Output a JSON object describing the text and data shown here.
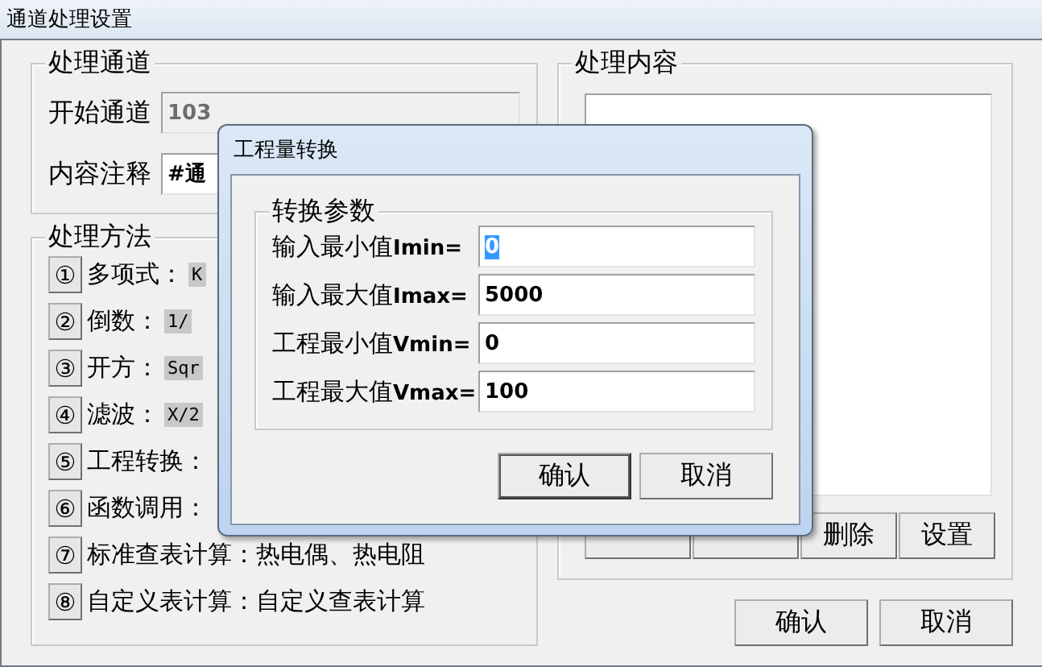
{
  "window": {
    "title": "通道处理设置"
  },
  "channel_group": {
    "title": "处理通道",
    "start_label": "开始通道",
    "start_field": {
      "value": "103",
      "disabled": true
    },
    "note_label": "内容注释",
    "note_field": {
      "value": "#通",
      "disabled": false
    }
  },
  "method_group": {
    "title": "处理方法",
    "items": [
      {
        "number": "①",
        "label": "多项式：",
        "formula": "K"
      },
      {
        "number": "②",
        "label": "倒数：",
        "formula": "1/"
      },
      {
        "number": "③",
        "label": "开方：",
        "formula": "Sqr"
      },
      {
        "number": "④",
        "label": "滤波：",
        "formula": "X/2"
      },
      {
        "number": "⑤",
        "label": "工程转换："
      },
      {
        "number": "⑥",
        "label": "函数调用："
      },
      {
        "number": "⑦",
        "label": "标准查表计算：热电偶、热电阻"
      },
      {
        "number": "⑧",
        "label": "自定义表计算：自定义查表计算"
      }
    ]
  },
  "content_group": {
    "title": "处理内容",
    "buttons": [
      {
        "kind": "blank"
      },
      {
        "kind": "blank"
      },
      {
        "kind": "text",
        "label": "删除"
      },
      {
        "kind": "text",
        "label": "设置"
      }
    ]
  },
  "buttons": [
    {
      "label": "确认",
      "default": false
    },
    {
      "label": "取消",
      "default": false
    }
  ],
  "dialog": {
    "title": "工程量转换",
    "group_title": "转换参数",
    "fields": [
      {
        "label": "输入最小值",
        "symbol": "Imin=",
        "value": "0",
        "text_selected": true
      },
      {
        "label": "输入最大值",
        "symbol": "Imax=",
        "value": "5000",
        "text_selected": false
      },
      {
        "label": "工程最小值",
        "symbol": "Vmin=",
        "value": "0",
        "text_selected": false
      },
      {
        "label": "工程最大值",
        "symbol": "Vmax=",
        "value": "100",
        "text_selected": false
      }
    ],
    "buttons": [
      {
        "label": "确认",
        "default": true
      },
      {
        "label": "取消",
        "default": false
      }
    ]
  }
}
